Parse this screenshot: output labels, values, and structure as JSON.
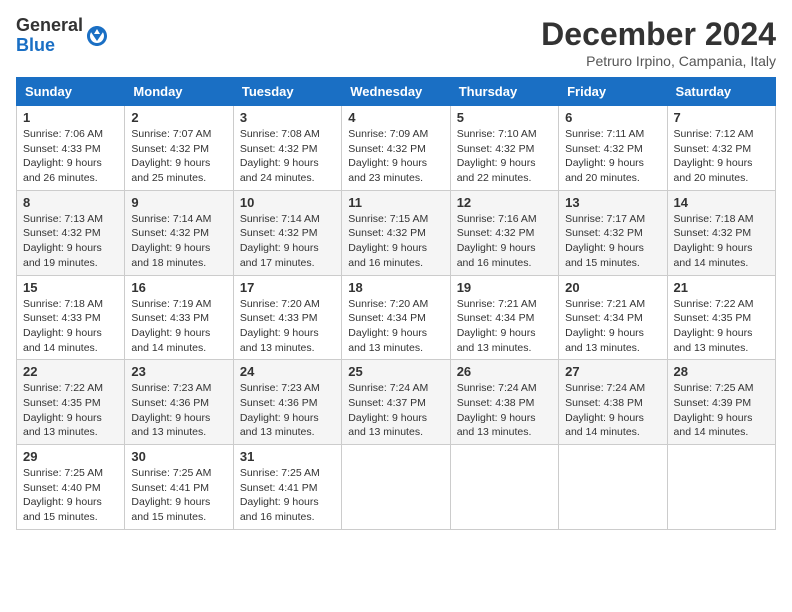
{
  "header": {
    "logo_general": "General",
    "logo_blue": "Blue",
    "title": "December 2024",
    "location": "Petruro Irpino, Campania, Italy"
  },
  "columns": [
    "Sunday",
    "Monday",
    "Tuesday",
    "Wednesday",
    "Thursday",
    "Friday",
    "Saturday"
  ],
  "rows": [
    [
      {
        "day": "1",
        "sunrise": "7:06 AM",
        "sunset": "4:33 PM",
        "daylight": "9 hours and 26 minutes."
      },
      {
        "day": "2",
        "sunrise": "7:07 AM",
        "sunset": "4:32 PM",
        "daylight": "9 hours and 25 minutes."
      },
      {
        "day": "3",
        "sunrise": "7:08 AM",
        "sunset": "4:32 PM",
        "daylight": "9 hours and 24 minutes."
      },
      {
        "day": "4",
        "sunrise": "7:09 AM",
        "sunset": "4:32 PM",
        "daylight": "9 hours and 23 minutes."
      },
      {
        "day": "5",
        "sunrise": "7:10 AM",
        "sunset": "4:32 PM",
        "daylight": "9 hours and 22 minutes."
      },
      {
        "day": "6",
        "sunrise": "7:11 AM",
        "sunset": "4:32 PM",
        "daylight": "9 hours and 20 minutes."
      },
      {
        "day": "7",
        "sunrise": "7:12 AM",
        "sunset": "4:32 PM",
        "daylight": "9 hours and 20 minutes."
      }
    ],
    [
      {
        "day": "8",
        "sunrise": "7:13 AM",
        "sunset": "4:32 PM",
        "daylight": "9 hours and 19 minutes."
      },
      {
        "day": "9",
        "sunrise": "7:14 AM",
        "sunset": "4:32 PM",
        "daylight": "9 hours and 18 minutes."
      },
      {
        "day": "10",
        "sunrise": "7:14 AM",
        "sunset": "4:32 PM",
        "daylight": "9 hours and 17 minutes."
      },
      {
        "day": "11",
        "sunrise": "7:15 AM",
        "sunset": "4:32 PM",
        "daylight": "9 hours and 16 minutes."
      },
      {
        "day": "12",
        "sunrise": "7:16 AM",
        "sunset": "4:32 PM",
        "daylight": "9 hours and 16 minutes."
      },
      {
        "day": "13",
        "sunrise": "7:17 AM",
        "sunset": "4:32 PM",
        "daylight": "9 hours and 15 minutes."
      },
      {
        "day": "14",
        "sunrise": "7:18 AM",
        "sunset": "4:32 PM",
        "daylight": "9 hours and 14 minutes."
      }
    ],
    [
      {
        "day": "15",
        "sunrise": "7:18 AM",
        "sunset": "4:33 PM",
        "daylight": "9 hours and 14 minutes."
      },
      {
        "day": "16",
        "sunrise": "7:19 AM",
        "sunset": "4:33 PM",
        "daylight": "9 hours and 14 minutes."
      },
      {
        "day": "17",
        "sunrise": "7:20 AM",
        "sunset": "4:33 PM",
        "daylight": "9 hours and 13 minutes."
      },
      {
        "day": "18",
        "sunrise": "7:20 AM",
        "sunset": "4:34 PM",
        "daylight": "9 hours and 13 minutes."
      },
      {
        "day": "19",
        "sunrise": "7:21 AM",
        "sunset": "4:34 PM",
        "daylight": "9 hours and 13 minutes."
      },
      {
        "day": "20",
        "sunrise": "7:21 AM",
        "sunset": "4:34 PM",
        "daylight": "9 hours and 13 minutes."
      },
      {
        "day": "21",
        "sunrise": "7:22 AM",
        "sunset": "4:35 PM",
        "daylight": "9 hours and 13 minutes."
      }
    ],
    [
      {
        "day": "22",
        "sunrise": "7:22 AM",
        "sunset": "4:35 PM",
        "daylight": "9 hours and 13 minutes."
      },
      {
        "day": "23",
        "sunrise": "7:23 AM",
        "sunset": "4:36 PM",
        "daylight": "9 hours and 13 minutes."
      },
      {
        "day": "24",
        "sunrise": "7:23 AM",
        "sunset": "4:36 PM",
        "daylight": "9 hours and 13 minutes."
      },
      {
        "day": "25",
        "sunrise": "7:24 AM",
        "sunset": "4:37 PM",
        "daylight": "9 hours and 13 minutes."
      },
      {
        "day": "26",
        "sunrise": "7:24 AM",
        "sunset": "4:38 PM",
        "daylight": "9 hours and 13 minutes."
      },
      {
        "day": "27",
        "sunrise": "7:24 AM",
        "sunset": "4:38 PM",
        "daylight": "9 hours and 14 minutes."
      },
      {
        "day": "28",
        "sunrise": "7:25 AM",
        "sunset": "4:39 PM",
        "daylight": "9 hours and 14 minutes."
      }
    ],
    [
      {
        "day": "29",
        "sunrise": "7:25 AM",
        "sunset": "4:40 PM",
        "daylight": "9 hours and 15 minutes."
      },
      {
        "day": "30",
        "sunrise": "7:25 AM",
        "sunset": "4:41 PM",
        "daylight": "9 hours and 15 minutes."
      },
      {
        "day": "31",
        "sunrise": "7:25 AM",
        "sunset": "4:41 PM",
        "daylight": "9 hours and 16 minutes."
      },
      null,
      null,
      null,
      null
    ]
  ],
  "labels": {
    "sunrise": "Sunrise:",
    "sunset": "Sunset:",
    "daylight": "Daylight:"
  }
}
